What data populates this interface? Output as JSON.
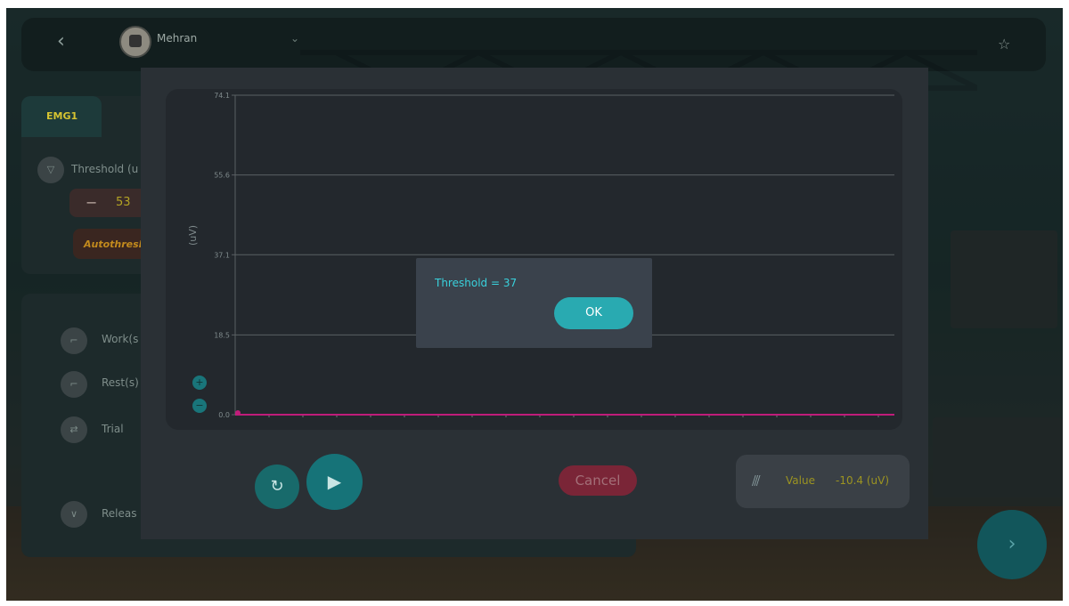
{
  "header": {
    "username": "Mehran"
  },
  "left_panel": {
    "tab_label": "EMG1",
    "threshold_label": "Threshold (u",
    "threshold_minus": "−",
    "threshold_value": "53",
    "autothreshold_label": "Autothresh",
    "work_label": "Work(s",
    "rest_label": "Rest(s)",
    "trial_label": "Trial",
    "release_label": "Releas"
  },
  "graph": {
    "y_unit": "(uV)",
    "zoom_in": "+",
    "zoom_out": "−"
  },
  "chart_data": {
    "type": "line",
    "ylabel": "(uV)",
    "y_ticks": [
      "74.1",
      "55.6",
      "37.1",
      "18.5",
      "0.0"
    ],
    "ylim": [
      0,
      74.1
    ],
    "grid": true,
    "series": [
      {
        "values": [
          0,
          0
        ]
      }
    ],
    "line_color": "#c01c7a",
    "grid_color": "#5a6063"
  },
  "controls": {
    "refresh_icon": "refresh-icon",
    "play_icon": "play-icon",
    "cancel_label": "Cancel"
  },
  "value_display": {
    "label": "Value",
    "value": "-10.4 (uV)"
  },
  "alert": {
    "message": "Threshold = 37",
    "ok_label": "OK"
  },
  "colors": {
    "accent": "#29aab1",
    "alert_text": "#39d1dc",
    "cancel": "#7a2537",
    "value_text": "#9c9421"
  }
}
